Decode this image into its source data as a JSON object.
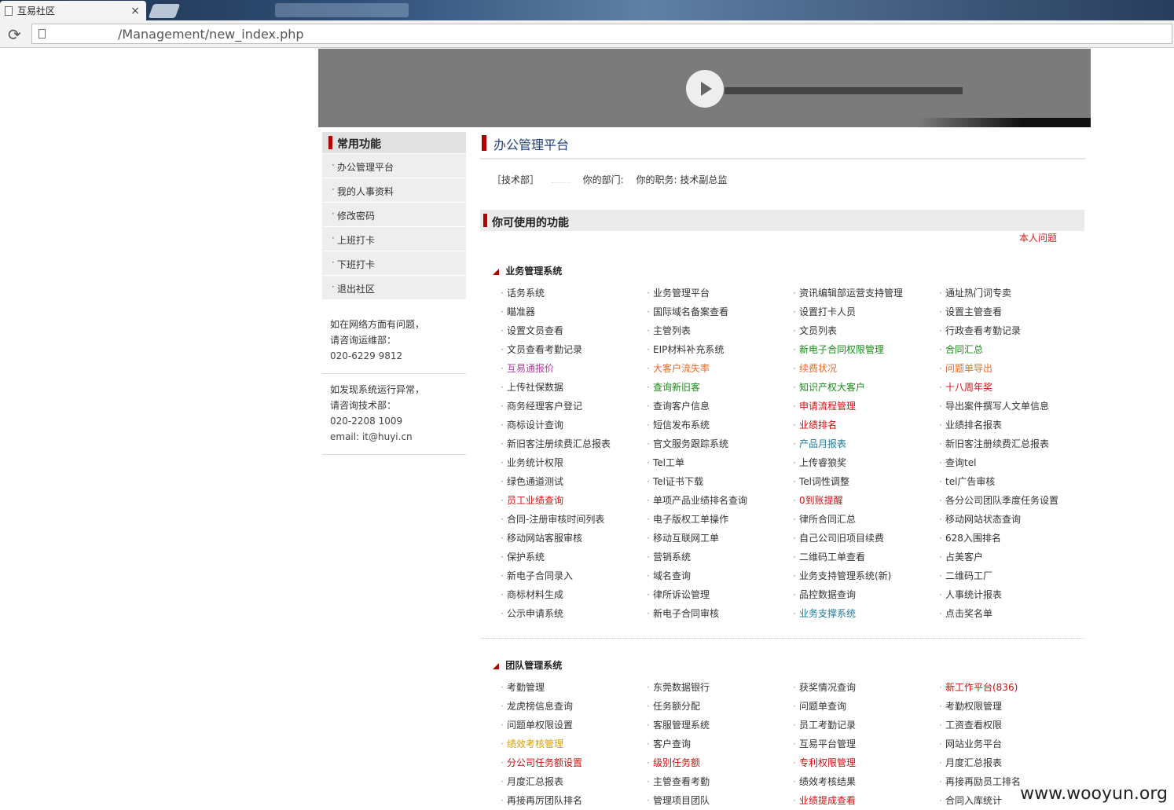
{
  "browser": {
    "tab_title": "互易社区",
    "tab_close": "×",
    "url": "/Management/new_index.php"
  },
  "sidebar": {
    "heading": "常用功能",
    "items": [
      "办公管理平台",
      "我的人事资料",
      "修改密码",
      "上班打卡",
      "下班打卡",
      "退出社区"
    ],
    "support1": {
      "line1": "如在网络方面有问题，",
      "line2": "请咨询运维部：",
      "phone": "020-6229 9812"
    },
    "support2": {
      "line1": "如发现系统运行异常，",
      "line2": "请咨询技术部：",
      "phone": "020-2208 1009",
      "email": "email: it@huyi.cn"
    }
  },
  "main": {
    "title": "办公管理平台",
    "user": {
      "dept_tag": "［技术部］",
      "dept_label": "你的部门:",
      "role_label": "你的职务: 技术副总监"
    },
    "functions_heading": "你可使用的功能",
    "my_issue": "本人问题",
    "systems": [
      {
        "name": "业务管理系统",
        "links": [
          {
            "t": "话务系统"
          },
          {
            "t": "业务管理平台"
          },
          {
            "t": "资讯编辑部运营支持管理"
          },
          {
            "t": "通址热门词专卖"
          },
          {
            "t": "瞄准器"
          },
          {
            "t": "国际域名备案查看"
          },
          {
            "t": "设置打卡人员"
          },
          {
            "t": "设置主管查看"
          },
          {
            "t": "设置文员查看"
          },
          {
            "t": "主管列表"
          },
          {
            "t": "文员列表"
          },
          {
            "t": "行政查看考勤记录"
          },
          {
            "t": "文员查看考勤记录"
          },
          {
            "t": "EIP材料补充系统"
          },
          {
            "t": "新电子合同权限管理",
            "c": "green"
          },
          {
            "t": "合同汇总",
            "c": "green"
          },
          {
            "t": "互易通报价",
            "c": "purple"
          },
          {
            "t": "大客户流失率",
            "c": "orange"
          },
          {
            "t": "续费状况",
            "c": "orange"
          },
          {
            "t": "问题单导出",
            "c": "orange"
          },
          {
            "t": "上传社保数据"
          },
          {
            "t": "查询新旧客",
            "c": "green"
          },
          {
            "t": "知识产权大客户",
            "c": "green"
          },
          {
            "t": "十八周年奖",
            "c": "red"
          },
          {
            "t": "商务经理客户登记"
          },
          {
            "t": "查询客户信息"
          },
          {
            "t": "申请流程管理",
            "c": "red"
          },
          {
            "t": "导出案件撰写人文单信息"
          },
          {
            "t": "商标设计查询"
          },
          {
            "t": "短信发布系统"
          },
          {
            "t": "业绩排名",
            "c": "red"
          },
          {
            "t": "业绩排名报表"
          },
          {
            "t": "新旧客注册续费汇总报表"
          },
          {
            "t": "官文服务跟踪系统"
          },
          {
            "t": "产品月报表",
            "c": "blue"
          },
          {
            "t": "新旧客注册续费汇总报表"
          },
          {
            "t": "业务统计权限"
          },
          {
            "t": "Tel工单"
          },
          {
            "t": "上传睿狼奖"
          },
          {
            "t": "查询tel"
          },
          {
            "t": "绿色通道测试"
          },
          {
            "t": "Tel证书下载"
          },
          {
            "t": "Tel词性调整"
          },
          {
            "t": "tel广告审核"
          },
          {
            "t": "员工业绩查询",
            "c": "red"
          },
          {
            "t": "单项产品业绩排名查询"
          },
          {
            "t": "0到账提醒",
            "c": "red"
          },
          {
            "t": "各分公司团队季度任务设置"
          },
          {
            "t": "合同-注册审核时间列表"
          },
          {
            "t": "电子版权工单操作"
          },
          {
            "t": "律所合同汇总"
          },
          {
            "t": "移动网站状态查询"
          },
          {
            "t": "移动网站客服审核"
          },
          {
            "t": "移动互联网工单"
          },
          {
            "t": "自己公司旧项目续费"
          },
          {
            "t": "628入围排名"
          },
          {
            "t": "保护系统"
          },
          {
            "t": "营销系统"
          },
          {
            "t": "二维码工单查看"
          },
          {
            "t": "占美客户"
          },
          {
            "t": "新电子合同录入"
          },
          {
            "t": "域名查询"
          },
          {
            "t": "业务支持管理系统(新)"
          },
          {
            "t": "二维码工厂"
          },
          {
            "t": "商标材料生成"
          },
          {
            "t": "律所诉讼管理"
          },
          {
            "t": "品控数据查询"
          },
          {
            "t": "人事统计报表"
          },
          {
            "t": "公示申请系统"
          },
          {
            "t": "新电子合同审核"
          },
          {
            "t": "业务支撑系统",
            "c": "blue"
          },
          {
            "t": "点击奖名单"
          }
        ]
      },
      {
        "name": "团队管理系统",
        "links": [
          {
            "t": "考勤管理"
          },
          {
            "t": "东莞数据银行"
          },
          {
            "t": "获奖情况查询"
          },
          {
            "t": "新工作平台(836)",
            "c": "red"
          },
          {
            "t": "龙虎榜信息查询"
          },
          {
            "t": "任务额分配"
          },
          {
            "t": "问题单查询"
          },
          {
            "t": "考勤权限管理"
          },
          {
            "t": "问题单权限设置"
          },
          {
            "t": "客服管理系统"
          },
          {
            "t": "员工考勤记录"
          },
          {
            "t": "工资查看权限"
          },
          {
            "t": "绩效考核管理",
            "c": "gold"
          },
          {
            "t": "客户查询"
          },
          {
            "t": "互易平台管理"
          },
          {
            "t": "网站业务平台"
          },
          {
            "t": "分公司任务额设置",
            "c": "red"
          },
          {
            "t": "级别任务额",
            "c": "red"
          },
          {
            "t": "专利权限管理",
            "c": "red"
          },
          {
            "t": "月度汇总报表"
          },
          {
            "t": "月度汇总报表"
          },
          {
            "t": "主管查看考勤"
          },
          {
            "t": "绩效考核结果"
          },
          {
            "t": "再接再励员工排名"
          },
          {
            "t": "再接再厉团队排名"
          },
          {
            "t": "管理项目团队"
          },
          {
            "t": "业绩提成查看",
            "c": "red"
          },
          {
            "t": "合同入库统计"
          }
        ]
      }
    ]
  },
  "watermark": "www.wooyun.org",
  "colors": {
    "accent_red": "#b10000",
    "title_blue": "#1f3f7f",
    "link_green": "#1a8a1a",
    "link_red": "#d01010"
  }
}
